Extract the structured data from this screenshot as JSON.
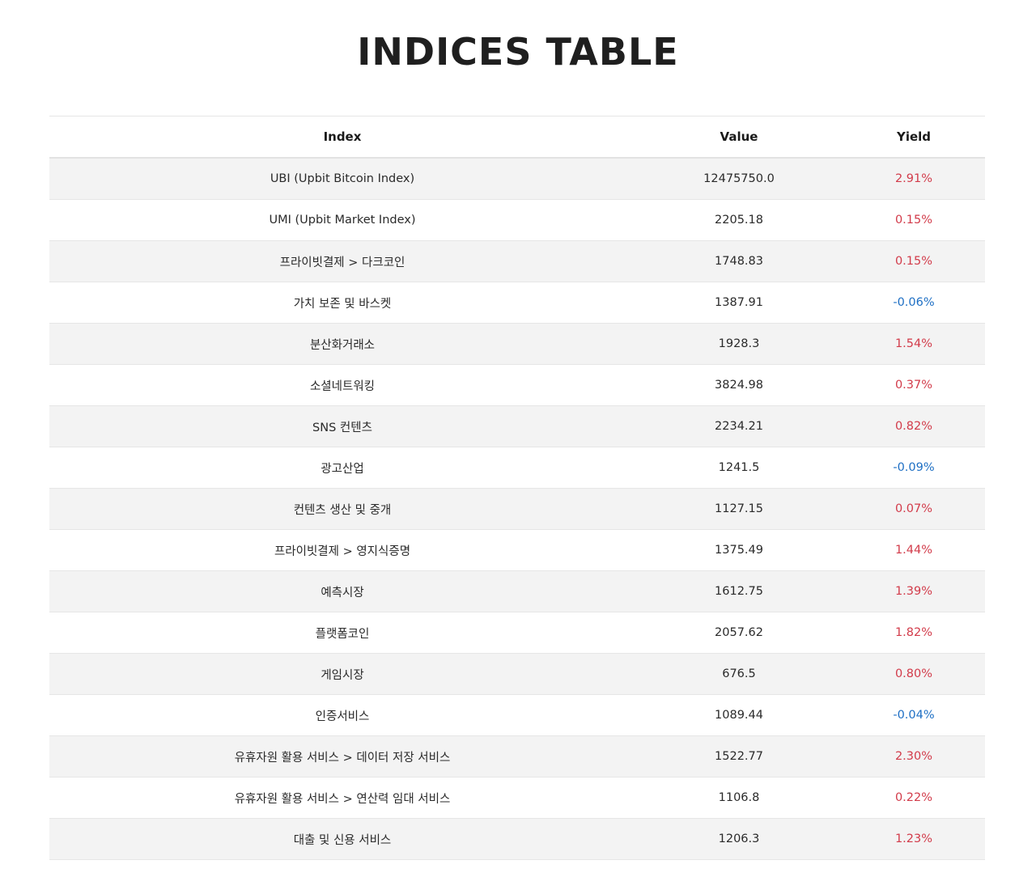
{
  "page": {
    "title": "INDICES TABLE"
  },
  "colors": {
    "positive": "#d23b4a",
    "negative": "#1e6fc4"
  },
  "table": {
    "headers": {
      "index": "Index",
      "value": "Value",
      "yield": "Yield"
    },
    "rows": [
      {
        "index": "UBI (Upbit Bitcoin Index)",
        "value": "12475750.0",
        "yield": "2.91%"
      },
      {
        "index": "UMI (Upbit Market Index)",
        "value": "2205.18",
        "yield": "0.15%"
      },
      {
        "index": "프라이빗결제 > 다크코인",
        "value": "1748.83",
        "yield": "0.15%"
      },
      {
        "index": "가치 보존 및 바스켓",
        "value": "1387.91",
        "yield": "-0.06%"
      },
      {
        "index": "분산화거래소",
        "value": "1928.3",
        "yield": "1.54%"
      },
      {
        "index": "소셜네트워킹",
        "value": "3824.98",
        "yield": "0.37%"
      },
      {
        "index": "SNS 컨텐츠",
        "value": "2234.21",
        "yield": "0.82%"
      },
      {
        "index": "광고산업",
        "value": "1241.5",
        "yield": "-0.09%"
      },
      {
        "index": "컨텐츠 생산 및 중개",
        "value": "1127.15",
        "yield": "0.07%"
      },
      {
        "index": "프라이빗결제 > 영지식증명",
        "value": "1375.49",
        "yield": "1.44%"
      },
      {
        "index": "예측시장",
        "value": "1612.75",
        "yield": "1.39%"
      },
      {
        "index": "플랫폼코인",
        "value": "2057.62",
        "yield": "1.82%"
      },
      {
        "index": "게임시장",
        "value": "676.5",
        "yield": "0.80%"
      },
      {
        "index": "인증서비스",
        "value": "1089.44",
        "yield": "-0.04%"
      },
      {
        "index": "유휴자원 활용 서비스 > 데이터 저장 서비스",
        "value": "1522.77",
        "yield": "2.30%"
      },
      {
        "index": "유휴자원 활용 서비스 > 연산력 임대 서비스",
        "value": "1106.8",
        "yield": "0.22%"
      },
      {
        "index": "대출 및 신용 서비스",
        "value": "1206.3",
        "yield": "1.23%"
      }
    ]
  }
}
